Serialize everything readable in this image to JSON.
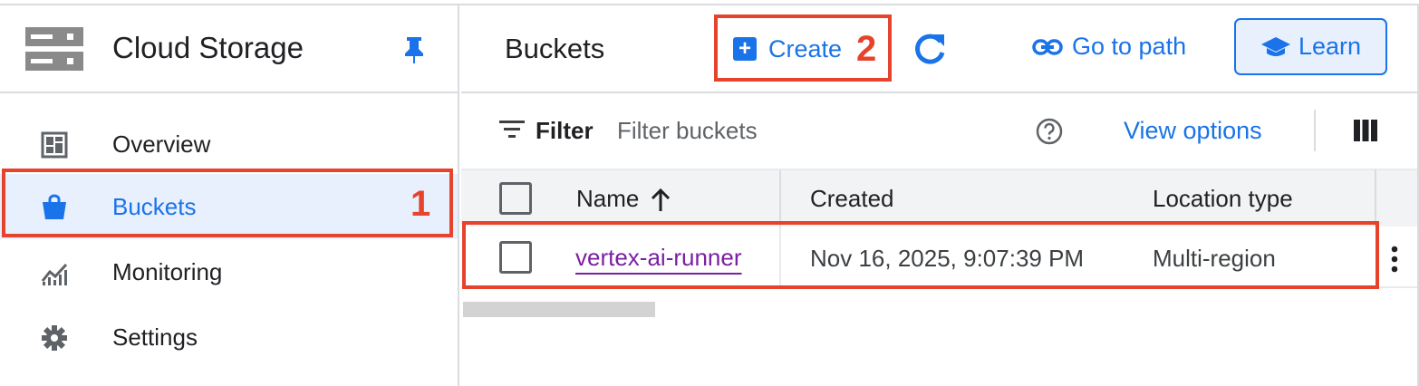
{
  "sidebar": {
    "product_title": "Cloud Storage",
    "icons": {
      "product": "storage-icon",
      "pin": "pin-icon"
    },
    "items": [
      {
        "label": "Overview",
        "icon": "dashboard-icon",
        "active": false
      },
      {
        "label": "Buckets",
        "icon": "bucket-icon",
        "active": true
      },
      {
        "label": "Monitoring",
        "icon": "chart-icon",
        "active": false
      },
      {
        "label": "Settings",
        "icon": "gear-icon",
        "active": false
      }
    ]
  },
  "header": {
    "title": "Buckets",
    "create_label": "Create",
    "go_to_path_label": "Go to path",
    "learn_label": "Learn"
  },
  "filter_bar": {
    "filter_label": "Filter",
    "placeholder": "Filter buckets",
    "view_options_label": "View options"
  },
  "table": {
    "columns": [
      "Name",
      "Created",
      "Location type"
    ],
    "rows": [
      {
        "name": "vertex-ai-runner",
        "created": "Nov 16, 2025, 9:07:39 PM",
        "location_type": "Multi-region"
      }
    ]
  },
  "annotations": {
    "step1": "1",
    "step2": "2"
  },
  "colors": {
    "accent": "#1a73e8",
    "active_bg": "#e8f0fe",
    "annotation": "#e5432b",
    "visited_link": "#7b1fa2"
  }
}
